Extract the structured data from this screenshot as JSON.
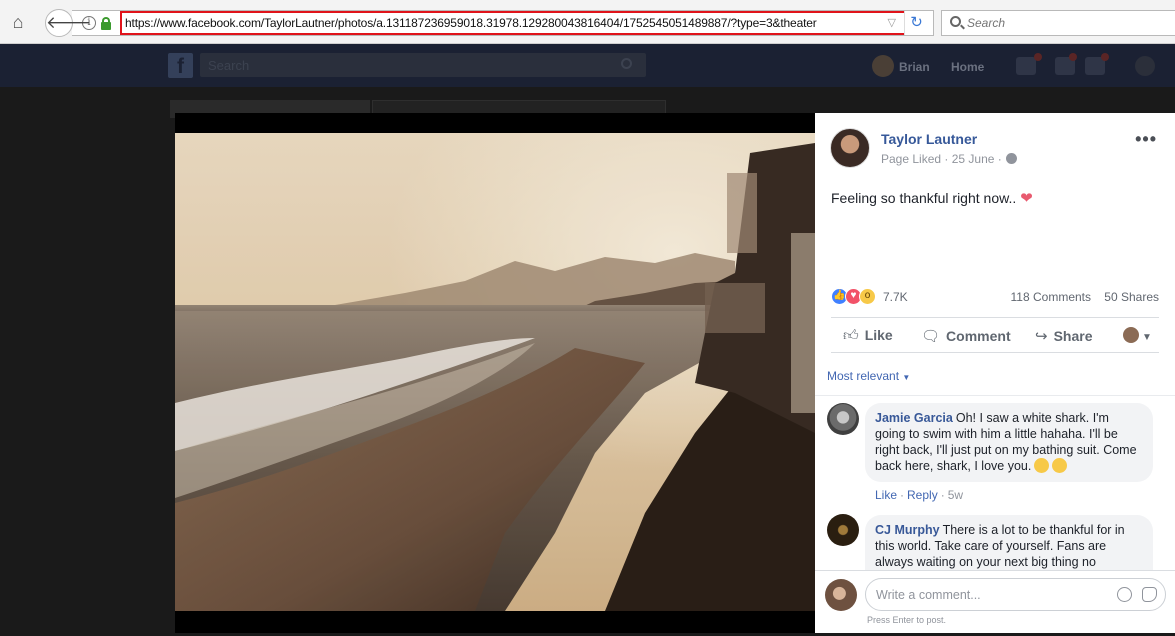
{
  "browser": {
    "url": "https://www.facebook.com/TaylorLautner/photos/a.131187236959018.31978.129280043816404/1752545051489887/?type=3&theater",
    "search_placeholder": "Search",
    "icons": [
      "home-icon",
      "back-arrow-icon",
      "info-icon",
      "lock-icon",
      "dropdown-icon",
      "reload-icon",
      "search-icon"
    ]
  },
  "fb_header": {
    "search_placeholder": "Search",
    "user_name": "Brian",
    "home_label": "Home"
  },
  "post": {
    "author": "Taylor Lautner",
    "meta": "Page Liked · 25 June ·",
    "text": "Feeling so thankful right now..",
    "reaction_count": "7.7K",
    "comments_label": "118 Comments",
    "shares_label": "50 Shares"
  },
  "actions": {
    "like": "Like",
    "comment": "Comment",
    "share": "Share"
  },
  "comments_filter": "Most relevant",
  "comments": [
    {
      "name": "Jamie Garcia",
      "text": "Oh! I saw a white shark. I'm going to swim with him a little hahaha. I'll be right back, I'll just put on my bathing suit. Come back here, shark, I love you.",
      "like": "Like",
      "reply": "Reply",
      "time": "5w"
    },
    {
      "name": "CJ Murphy",
      "text": "There is a lot to be thankful for in this world. Take care of yourself. Fans are always waiting on your next big thing no"
    }
  ],
  "compose": {
    "placeholder": "Write a comment...",
    "hint": "Press Enter to post."
  },
  "colors": {
    "link_blue": "#365899",
    "url_highlight": "#e0131a",
    "like_blue": "#4080ff",
    "love_red": "#f25268"
  }
}
